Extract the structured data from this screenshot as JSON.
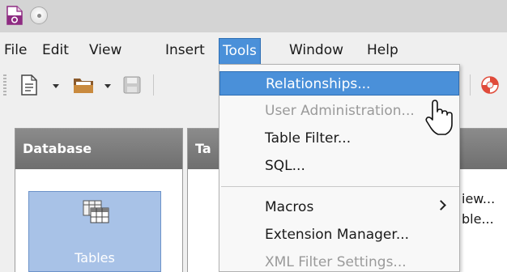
{
  "menubar": {
    "items": [
      {
        "label": "File"
      },
      {
        "label": "Edit"
      },
      {
        "label": "View"
      },
      {
        "label": "Insert"
      },
      {
        "label": "Tools"
      },
      {
        "label": "Window"
      },
      {
        "label": "Help"
      }
    ],
    "active": "Tools"
  },
  "tools_menu": {
    "items": [
      {
        "label": "Relationships...",
        "state": "highlighted"
      },
      {
        "label": "User Administration...",
        "state": "disabled"
      },
      {
        "label": "Table Filter...",
        "state": "enabled"
      },
      {
        "label": "SQL...",
        "state": "enabled"
      },
      {
        "label": "Macros",
        "state": "submenu"
      },
      {
        "label": "Extension Manager...",
        "state": "enabled"
      },
      {
        "label": "XML Filter Settings...",
        "state": "disabled"
      }
    ]
  },
  "database_panel": {
    "header": "Database",
    "tables_label": "Tables"
  },
  "tasks_panel": {
    "header_partial": "Ta"
  },
  "background_text": {
    "view": "iew...",
    "ble": "ble..."
  },
  "colors": {
    "highlight": "#4a90d9",
    "panel_header": "#7c7c7c",
    "tables_tile": "#a8c2e7"
  },
  "icons": [
    "base-app-icon",
    "window-menu-icon",
    "new-document-icon",
    "open-folder-icon",
    "save-icon",
    "help-lifebuoy-icon",
    "mouse-cursor-icon"
  ]
}
